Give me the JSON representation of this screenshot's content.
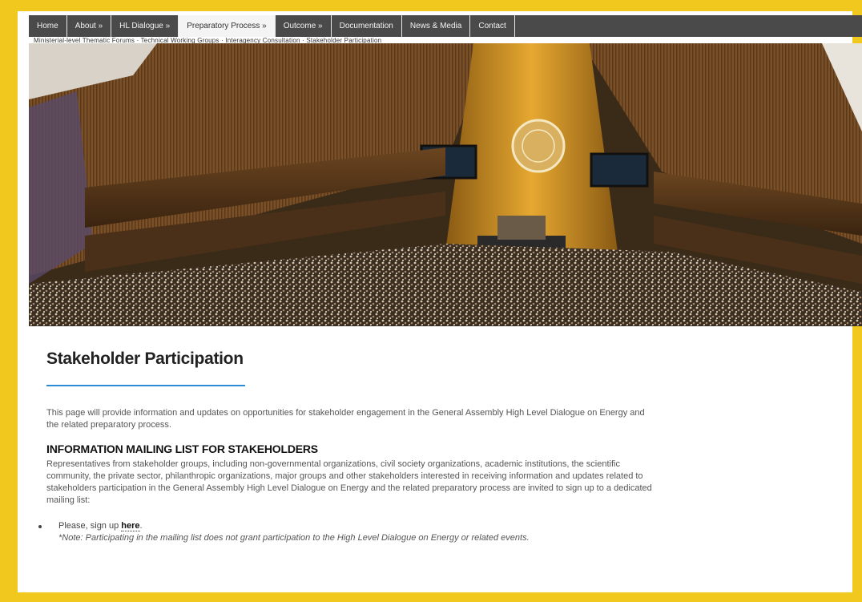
{
  "nav": {
    "items": [
      {
        "label": "Home"
      },
      {
        "label": "About »"
      },
      {
        "label": "HL Dialogue »"
      },
      {
        "label": "Preparatory Process »"
      },
      {
        "label": "Outcome »"
      },
      {
        "label": "Documentation"
      },
      {
        "label": "News & Media"
      },
      {
        "label": "Contact"
      }
    ],
    "active_index": 3,
    "subnav_text": "Ministerial-level Thematic Forums · Technical Working Groups · Interagency Consultation · Stakeholder Participation"
  },
  "page": {
    "title": "Stakeholder Participation",
    "intro": "This page will provide information and updates on opportunities for stakeholder engagement in the General Assembly High Level Dialogue on Energy and the related preparatory process.",
    "section_heading": "INFORMATION MAILING LIST FOR STAKEHOLDERS",
    "section_body": "Representatives from stakeholder groups, including non-governmental organizations, civil society organizations, academic institutions, the scientific community, the private sector, philanthropic organizations, major groups and other stakeholders interested in receiving information and updates related to stakeholders participation in the General Assembly High Level Dialogue on Energy and the related preparatory process are invited to sign up to a dedicated mailing list:",
    "signup_prefix": "Please, sign up ",
    "signup_link": "here",
    "signup_suffix": ".",
    "note": "*Note: Participating in the mailing list does not grant participation to the High Level Dialogue on Energy or related events."
  },
  "colors": {
    "frame": "#f0c81e",
    "nav_bg": "#4a4a4a",
    "title_rule": "#2a8bd6"
  },
  "icons": {
    "hero": "general-assembly-hall-photo",
    "emblem": "un-emblem-icon"
  }
}
